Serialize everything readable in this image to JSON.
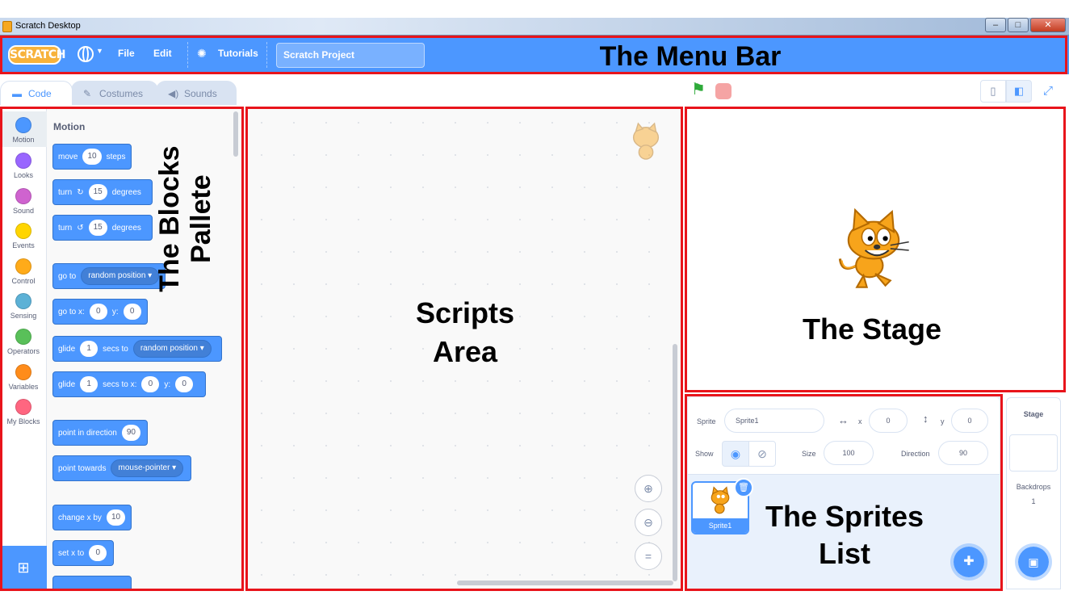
{
  "window": {
    "title": "Scratch Desktop",
    "min": "–",
    "max": "□",
    "close": "✕"
  },
  "menubar": {
    "logo": "SCRATCH",
    "file": "File",
    "edit": "Edit",
    "tutorials": "Tutorials",
    "project_title": "Scratch Project"
  },
  "tabs": {
    "code": "Code",
    "costumes": "Costumes",
    "sounds": "Sounds"
  },
  "categories": [
    {
      "label": "Motion",
      "color": "#4c97ff"
    },
    {
      "label": "Looks",
      "color": "#9966ff"
    },
    {
      "label": "Sound",
      "color": "#cf63cf"
    },
    {
      "label": "Events",
      "color": "#ffd500"
    },
    {
      "label": "Control",
      "color": "#ffab19"
    },
    {
      "label": "Sensing",
      "color": "#5cb1d6"
    },
    {
      "label": "Operators",
      "color": "#59c059"
    },
    {
      "label": "Variables",
      "color": "#ff8c1a"
    },
    {
      "label": "My Blocks",
      "color": "#ff6680"
    }
  ],
  "palette": {
    "title": "Motion",
    "move": {
      "a": "move",
      "v": "10",
      "b": "steps"
    },
    "turn_cw": {
      "a": "turn",
      "v": "15",
      "b": "degrees"
    },
    "turn_ccw": {
      "a": "turn",
      "v": "15",
      "b": "degrees"
    },
    "goto": {
      "a": "go to",
      "opt": "random position"
    },
    "gotoxy": {
      "a": "go to x:",
      "x": "0",
      "b": "y:",
      "y": "0"
    },
    "glide": {
      "a": "glide",
      "v": "1",
      "b": "secs to",
      "opt": "random position"
    },
    "glidexy": {
      "a": "glide",
      "v": "1",
      "b": "secs to x:",
      "x": "0",
      "c": "y:",
      "y": "0"
    },
    "point_dir": {
      "a": "point in direction",
      "v": "90"
    },
    "point_towards": {
      "a": "point towards",
      "opt": "mouse-pointer"
    },
    "change_x": {
      "a": "change x by",
      "v": "10"
    },
    "set_x": {
      "a": "set x to",
      "v": "0"
    }
  },
  "sprite_info": {
    "sprite_label": "Sprite",
    "sprite_name": "Sprite1",
    "x_label": "x",
    "x_value": "0",
    "y_label": "y",
    "y_value": "0",
    "show_label": "Show",
    "size_label": "Size",
    "size_value": "100",
    "direction_label": "Direction",
    "direction_value": "90"
  },
  "sprites": [
    {
      "name": "Sprite1"
    }
  ],
  "stage_panel": {
    "title": "Stage",
    "backdrops_label": "Backdrops",
    "backdrops_count": "1"
  },
  "annotations": {
    "menu_bar": "The Menu Bar",
    "blocks_pallete": "The Blocks Pallete",
    "scripts_area_1": "Scripts",
    "scripts_area_2": "Area",
    "stage": "The Stage",
    "sprites_list_1": "The Sprites",
    "sprites_list_2": "List"
  },
  "colors": {
    "accent": "#4c97ff",
    "annotation": "#e8141b",
    "flag": "#2eaa3a",
    "stop": "#ec5959"
  }
}
